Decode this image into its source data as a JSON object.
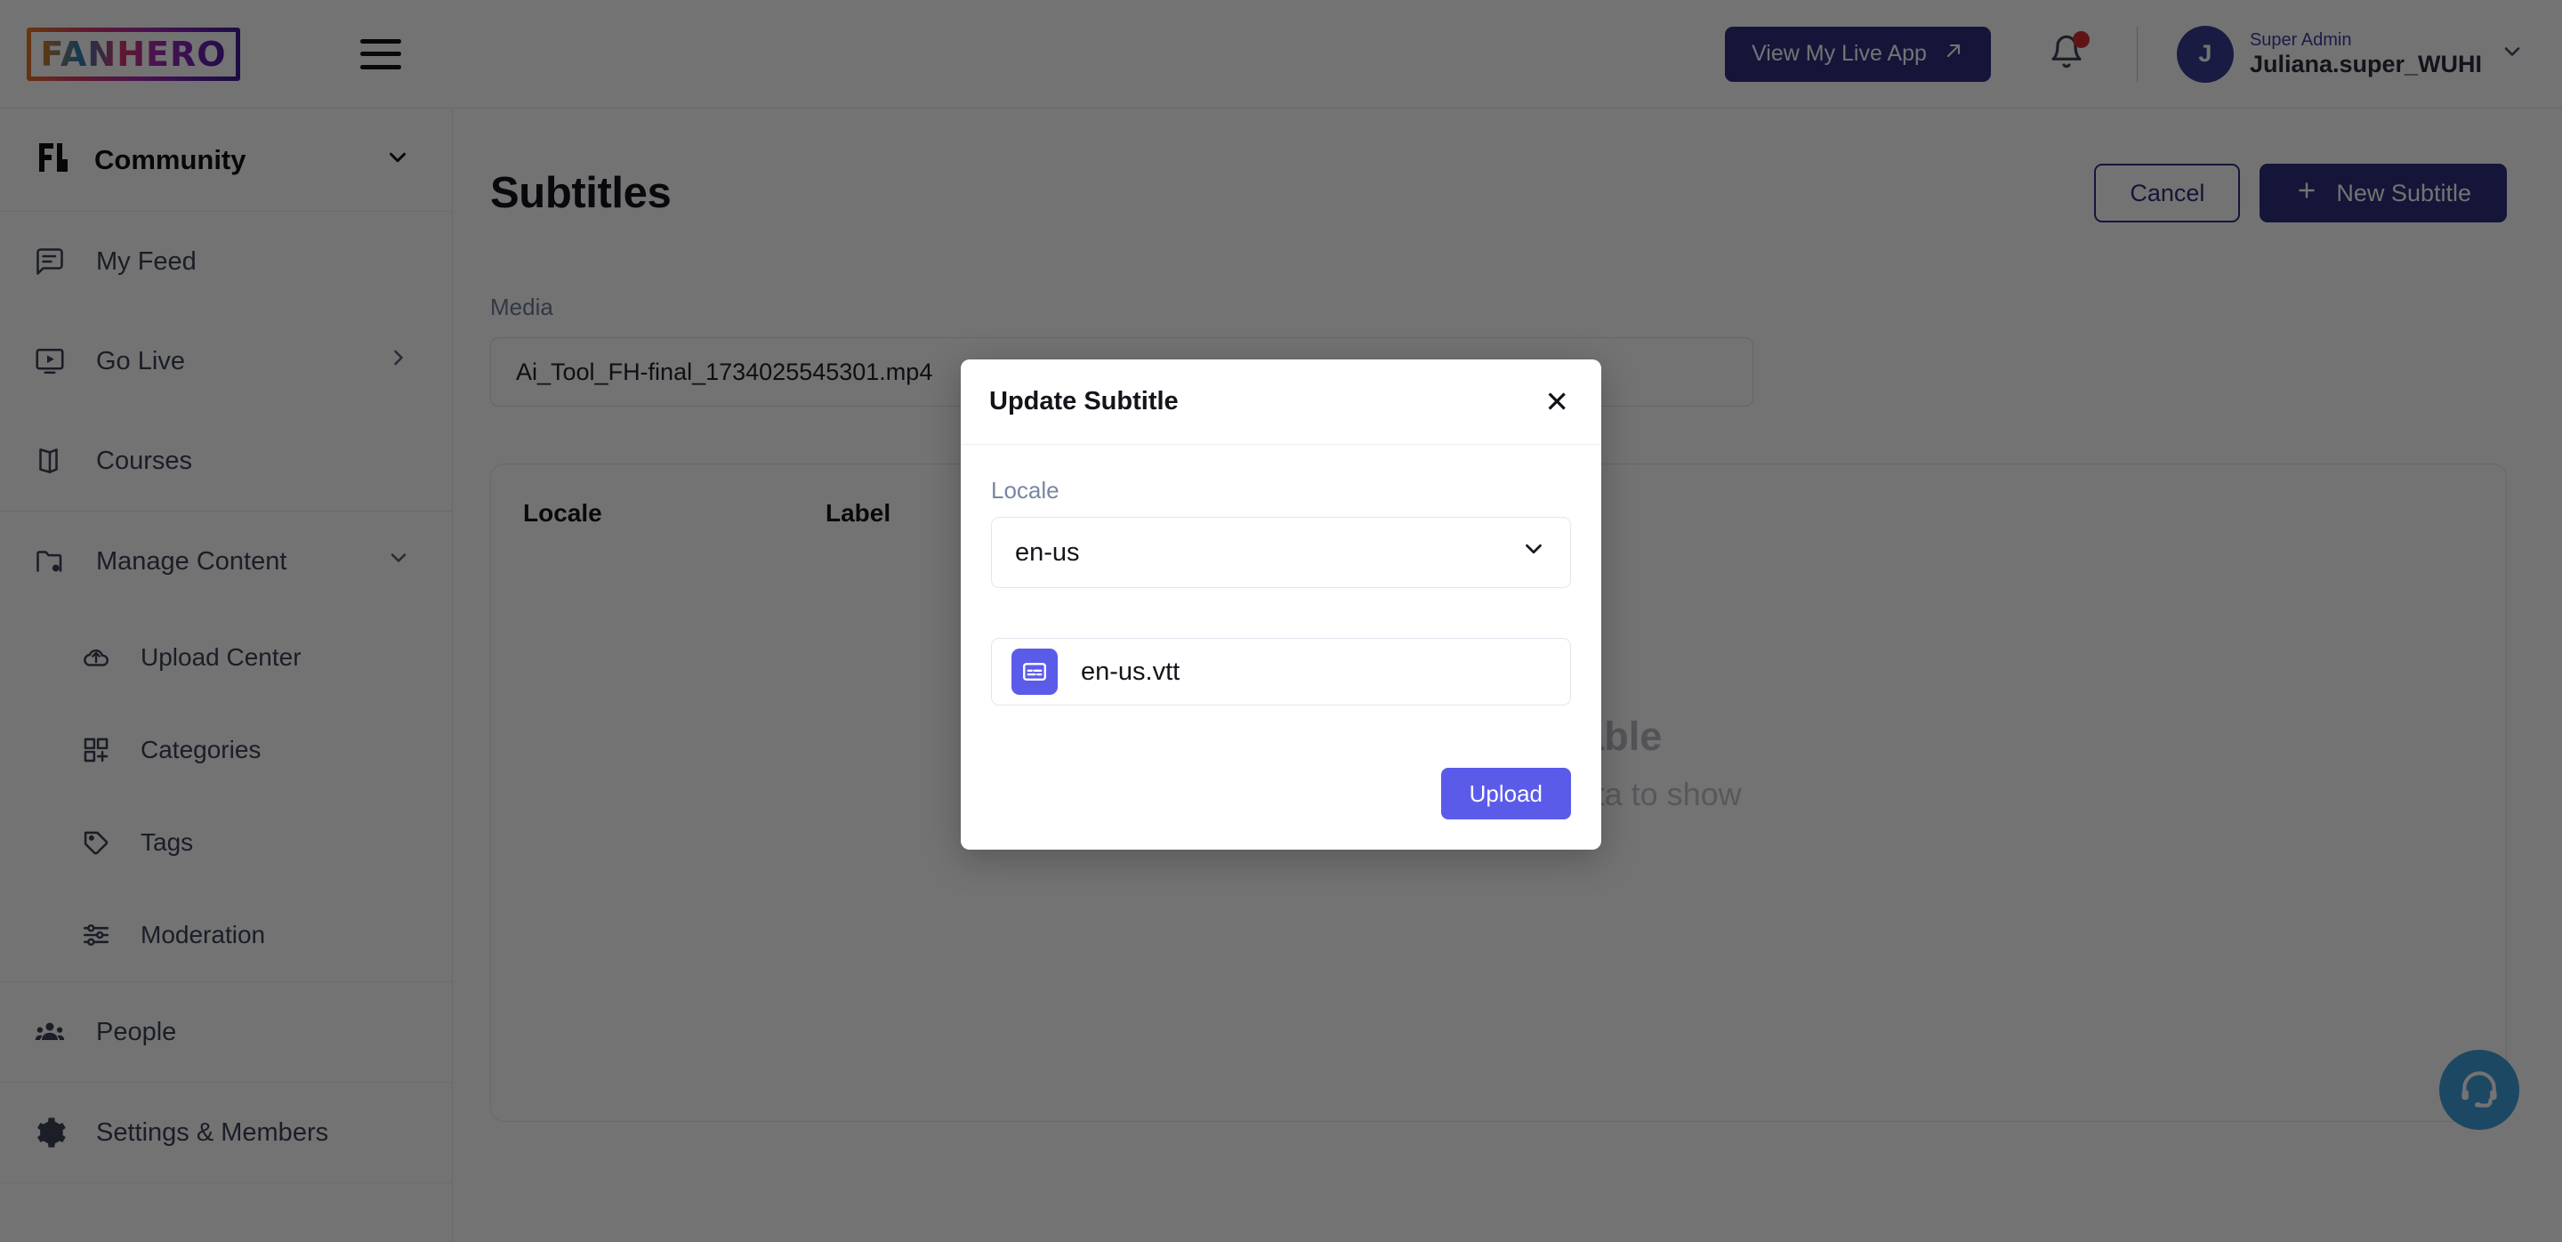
{
  "brand": {
    "logo_text": "FANHERO",
    "accent": "#2d2f7f",
    "modal_accent": "#5b5bea",
    "support_color": "#3fa0dc",
    "badge_color": "#d32f2f"
  },
  "topbar": {
    "menu_icon": "hamburger-icon",
    "live_app_label": "View My Live App",
    "live_app_icon": "arrow-up-right-icon",
    "bell_icon": "notification-bell-icon",
    "avatar_initial": "J",
    "user_role": "Super Admin",
    "user_name": "Juliana.super_WUHI",
    "user_caret_icon": "chevron-down-icon"
  },
  "sidebar": {
    "workspace": {
      "label": "Community",
      "icon": "fanhero-mark-icon",
      "caret": "chevron-down-icon"
    },
    "items": [
      {
        "label": "My Feed",
        "icon": "feed-icon",
        "caret": "",
        "sub": false
      },
      {
        "label": "Go Live",
        "icon": "live-video-icon",
        "caret": "chevron-right-icon",
        "sub": false
      },
      {
        "label": "Courses",
        "icon": "book-icon",
        "caret": "",
        "sub": false
      },
      {
        "label": "Manage Content",
        "icon": "folder-settings-icon",
        "caret": "chevron-down-icon",
        "sub": false
      },
      {
        "label": "Upload Center",
        "icon": "cloud-upload-icon",
        "caret": "",
        "sub": true
      },
      {
        "label": "Categories",
        "icon": "categories-grid-icon",
        "caret": "",
        "sub": true
      },
      {
        "label": "Tags",
        "icon": "tag-icon",
        "caret": "",
        "sub": true
      },
      {
        "label": "Moderation",
        "icon": "sliders-icon",
        "caret": "",
        "sub": true
      },
      {
        "label": "People",
        "icon": "people-icon",
        "caret": "",
        "sub": false
      },
      {
        "label": "Settings & Members",
        "icon": "gear-icon",
        "caret": "",
        "sub": false
      }
    ]
  },
  "main": {
    "page_title": "Subtitles",
    "cancel_label": "Cancel",
    "new_subtitle_label": "New Subtitle",
    "new_subtitle_icon": "plus-icon",
    "media_label": "Media",
    "media_value": "Ai_Tool_FH-final_1734025545301.mp4",
    "table": {
      "columns": [
        "Locale",
        "Label"
      ],
      "rows": [],
      "empty_title": "No data available",
      "empty_subtitle": "There is no available data to show"
    },
    "support_icon": "headset-support-icon"
  },
  "modal": {
    "title": "Update Subtitle",
    "close_icon": "close-icon",
    "locale_label": "Locale",
    "locale_value": "en-us",
    "locale_caret_icon": "chevron-down-icon",
    "file_icon": "subtitle-file-icon",
    "file_name": "en-us.vtt",
    "upload_label": "Upload"
  }
}
